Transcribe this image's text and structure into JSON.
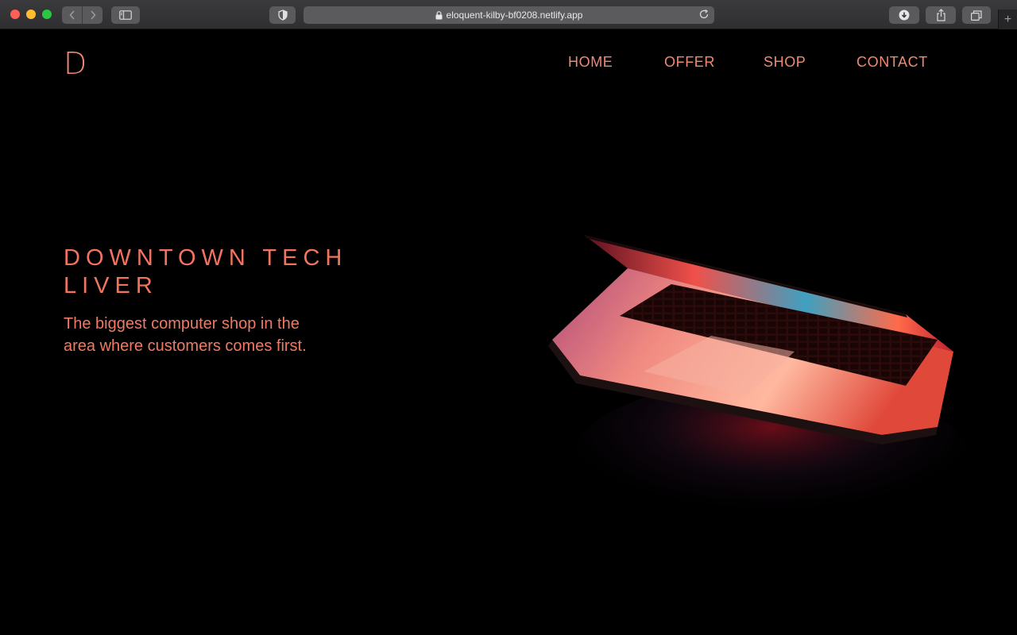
{
  "browser": {
    "url": "eloquent-kilby-bf0208.netlify.app",
    "new_tab_glyph": "+"
  },
  "site": {
    "logo": "D",
    "nav": [
      "HOME",
      "OFFER",
      "SHOP",
      "CONTACT"
    ]
  },
  "hero": {
    "title_line1": "DOWNTOWN TECH",
    "title_line2": "LIVER",
    "subtitle": "The biggest computer shop in the area where customers comes first."
  },
  "colors": {
    "accent": "#f08a72",
    "background": "#000000"
  }
}
